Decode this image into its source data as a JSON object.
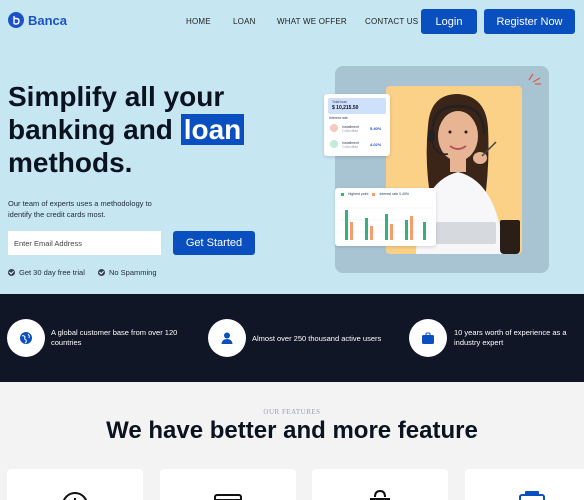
{
  "brand": {
    "name": "Banca"
  },
  "nav": {
    "home": "HOME",
    "loan": "LOAN",
    "offer": "WHAT WE OFFER",
    "contact": "CONTACT US"
  },
  "header": {
    "login_label": "Login",
    "register_label": "Register Now"
  },
  "hero": {
    "title_line1": "Simplify all your",
    "title_line2a": "banking and ",
    "title_highlight": "loan",
    "title_line3": "methods.",
    "description": "Our team of experts uses a methodology to identify the credit cards most.",
    "email_placeholder": "Enter Email Address",
    "cta_label": "Get Started",
    "check1": "Get 30 day free trial",
    "check2": "No Spamming"
  },
  "balance_card": {
    "label": "Total loan",
    "amount": "$ 10,215.50",
    "sub": "Interest rate",
    "rows": [
      {
        "name": "Installment",
        "sub": "Collectible",
        "value": "5.40%"
      },
      {
        "name": "Installment",
        "sub": "Collectible",
        "value": "4.02%"
      }
    ]
  },
  "chart_card": {
    "legend": [
      "Highest point",
      "Interest rate 0.40%"
    ],
    "colors": {
      "green": "#34b27b",
      "orange": "#f59e6b"
    }
  },
  "stats": [
    {
      "icon": "globe-icon",
      "text": "A global customer base from over 120 countries"
    },
    {
      "icon": "user-icon",
      "text": "Almost over 250 thousand active users"
    },
    {
      "icon": "briefcase-icon",
      "text": "10 years worth of experience as a industry expert"
    }
  ],
  "features": {
    "eyebrow": "OUR FEATURES",
    "title": "We have better and more feature"
  },
  "colors": {
    "accent": "#0a4fbf",
    "hero_bg": "#c6e6f2",
    "band": "#101626"
  }
}
